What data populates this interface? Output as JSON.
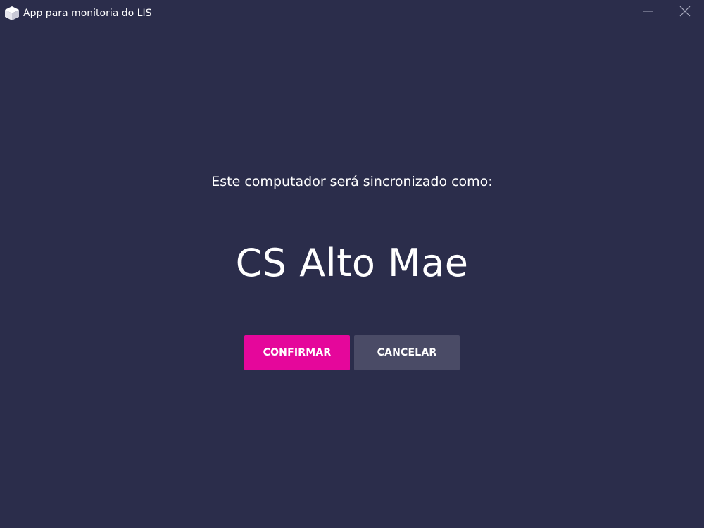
{
  "window": {
    "title": "App para monitoria do LIS",
    "icon": "cube-icon",
    "controls": {
      "minimize_icon": "minimize-icon",
      "close_icon": "close-icon"
    }
  },
  "sync": {
    "prompt": "Este computador será sincronizado como:",
    "computer_name": "CS Alto Mae"
  },
  "actions": {
    "confirm_label": "CONFIRMAR",
    "cancel_label": "CANCELAR"
  },
  "colors": {
    "background": "#2b2d4b",
    "confirm": "#e5079b",
    "cancel": "#4a4b66",
    "text": "#ffffff"
  }
}
